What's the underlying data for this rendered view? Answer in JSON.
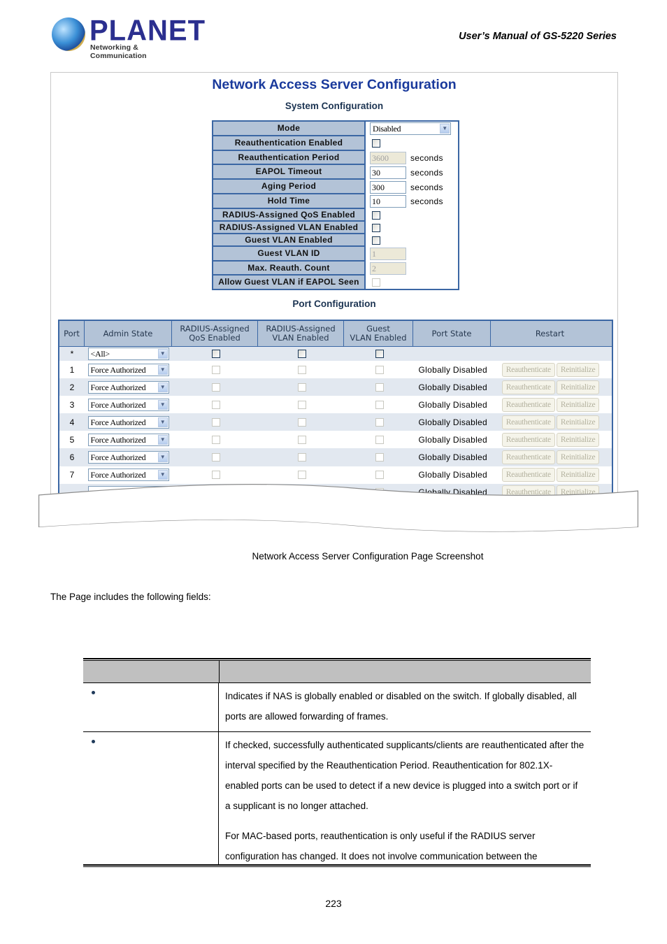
{
  "header": {
    "logo_word": "PLANET",
    "logo_tagline": "Networking & Communication",
    "manual_title": "User’s  Manual  of  GS-5220  Series"
  },
  "screenshot": {
    "title": "Network Access Server Configuration",
    "system_section_title": "System Configuration",
    "system_config": {
      "mode": {
        "label": "Mode",
        "value": "Disabled"
      },
      "reauth_enabled": {
        "label": "Reauthentication Enabled",
        "checked": false
      },
      "reauth_period": {
        "label": "Reauthentication Period",
        "value": "3600",
        "unit": "seconds",
        "disabled": true
      },
      "eapol_timeout": {
        "label": "EAPOL Timeout",
        "value": "30",
        "unit": "seconds"
      },
      "aging_period": {
        "label": "Aging Period",
        "value": "300",
        "unit": "seconds"
      },
      "hold_time": {
        "label": "Hold Time",
        "value": "10",
        "unit": "seconds"
      },
      "radius_qos": {
        "label": "RADIUS-Assigned QoS Enabled",
        "checked": false
      },
      "radius_vlan": {
        "label": "RADIUS-Assigned VLAN Enabled",
        "checked": false
      },
      "guest_vlan_enabled": {
        "label": "Guest VLAN Enabled",
        "checked": false
      },
      "guest_vlan_id": {
        "label": "Guest VLAN ID",
        "value": "1",
        "disabled": true
      },
      "max_reauth_count": {
        "label": "Max. Reauth. Count",
        "value": "2",
        "disabled": true
      },
      "allow_guest_eapol": {
        "label": "Allow Guest VLAN if EAPOL Seen",
        "checked": false,
        "disabled": true
      }
    },
    "port_section_title": "Port Configuration",
    "port_columns": {
      "port": "Port",
      "admin_state": "Admin State",
      "qos_line1": "RADIUS-Assigned",
      "qos_line2": "QoS Enabled",
      "vlan_line1": "RADIUS-Assigned",
      "vlan_line2": "VLAN Enabled",
      "guest_line1": "Guest",
      "guest_line2": "VLAN Enabled",
      "port_state": "Port State",
      "restart": "Restart"
    },
    "all_row": {
      "port": "*",
      "admin_state": "<All>"
    },
    "ports": [
      {
        "port": "1",
        "admin_state": "Force Authorized",
        "port_state": "Globally Disabled"
      },
      {
        "port": "2",
        "admin_state": "Force Authorized",
        "port_state": "Globally Disabled"
      },
      {
        "port": "3",
        "admin_state": "Force Authorized",
        "port_state": "Globally Disabled"
      },
      {
        "port": "4",
        "admin_state": "Force Authorized",
        "port_state": "Globally Disabled"
      },
      {
        "port": "5",
        "admin_state": "Force Authorized",
        "port_state": "Globally Disabled"
      },
      {
        "port": "6",
        "admin_state": "Force Authorized",
        "port_state": "Globally Disabled"
      },
      {
        "port": "7",
        "admin_state": "Force Authorized",
        "port_state": "Globally Disabled"
      },
      {
        "port": "",
        "admin_state": "",
        "port_state": "Globally Disabled"
      }
    ],
    "reauth_button": "Reauthenticate",
    "reinit_button": "Reinitialize"
  },
  "caption": "Network Access Server Configuration Page Screenshot",
  "intro_text": "The Page includes the following fields:",
  "fields_table": {
    "rows": [
      {
        "paragraphs": [
          "Indicates if NAS is globally enabled or disabled on the switch. If globally disabled, all ports are allowed forwarding of frames."
        ]
      },
      {
        "paragraphs": [
          "If checked, successfully authenticated supplicants/clients are reauthenticated after the interval specified by the Reauthentication Period. Reauthentication for 802.1X-enabled ports can be used to detect if a new device is plugged into a switch port or if a supplicant is no longer attached.",
          "For MAC-based ports, reauthentication is only useful if the RADIUS server configuration has changed. It does not involve communication between the"
        ]
      }
    ]
  },
  "page_number": "223"
}
